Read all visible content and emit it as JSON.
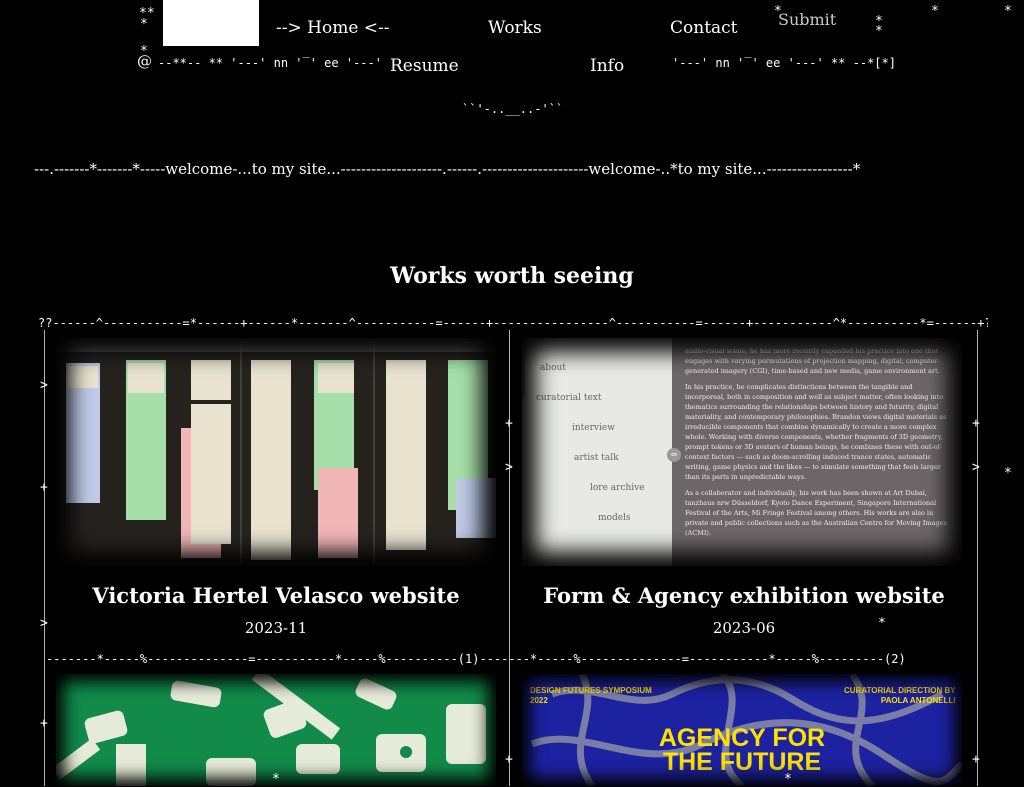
{
  "header": {
    "nav": {
      "home": "--> Home <--",
      "works": "Works",
      "contact": "Contact",
      "resume": "Resume",
      "info": "Info",
      "submit": "Submit"
    },
    "deco_left": "--**--  **  '---' nn '‾' ee '---'",
    "deco_right": "'---' nn '‾' ee '---'  **  --*[*]",
    "smile": "``'-..__..-'``"
  },
  "ticker": {
    "text": "---.-------*-------*-----welcome-...to my site...--------------------.------.---------------------welcome-..*to my site...-----------------*"
  },
  "section": {
    "title": "Works worth seeing"
  },
  "grid": {
    "top_border": "??------^-----------=*------+------*-------^-----------=------+----------------^-----------=------+-----------^*----------*=------+??",
    "mid_border": "-------*-----%--------------=-----------*-----%----------(1)-------*-----%--------------=-----------*-----%---------(2)"
  },
  "works": [
    {
      "title": "Victoria Hertel Velasco website",
      "date": "2023-11"
    },
    {
      "title": "Form & Agency exhibition website",
      "date": "2023-06"
    }
  ],
  "card2_preview": {
    "menu": [
      "about",
      "curatorial text",
      "interview",
      "artist talk",
      "lore archive",
      "models"
    ],
    "para1": "audio-visual scene, he has more recently expanded his practice into one that engages with varying permutations of projection mapping, digital, computer-generated imagery (CGI), time-based and new media, game environment art.",
    "para2": "In his practice, he complicates distinctions between the tangible and incorporeal, both in composition and well as subject matter, often looking into thematics surrounding the relationships between history and futurity, digital materiality, and contemporary philosophies. Brandon views digital materials as irreducible components that combine dynamically to create a more complex whole. Working with diverse components, whether fragments of 3D geometry, prompt tokens or 3D avatars of human beings, he combines these with out-of-context factors — such as doom-scrolling induced trance states, automatic writing, game physics and the likes — to simulate something that feels larger than its parts in unpredictable ways.",
    "para3": "As a collaborator and individually, his work has been shown at Art Dubai, tanzhaus nrw Düsseldorf, Kyoto Dance Experiment, Singapore International Festival of the Arts, Mi Fringe Festival among others. His works are also in private and public collections such as the Australian Centre for Moving Images (ACMI)."
  },
  "card4_preview": {
    "left_label": "DESIGN FUTURES SYMPOSIUM\n2022",
    "right_label": "CURATORIAL DIRECTION BY\nPAOLA ANTONELLI",
    "headline": "AGENCY FOR\nTHE FUTURE"
  },
  "colors": {
    "background": "#000000",
    "card3_bg": "#118a4a",
    "card4_bg": "#1c22a0",
    "card4_text": "#ffe100"
  }
}
